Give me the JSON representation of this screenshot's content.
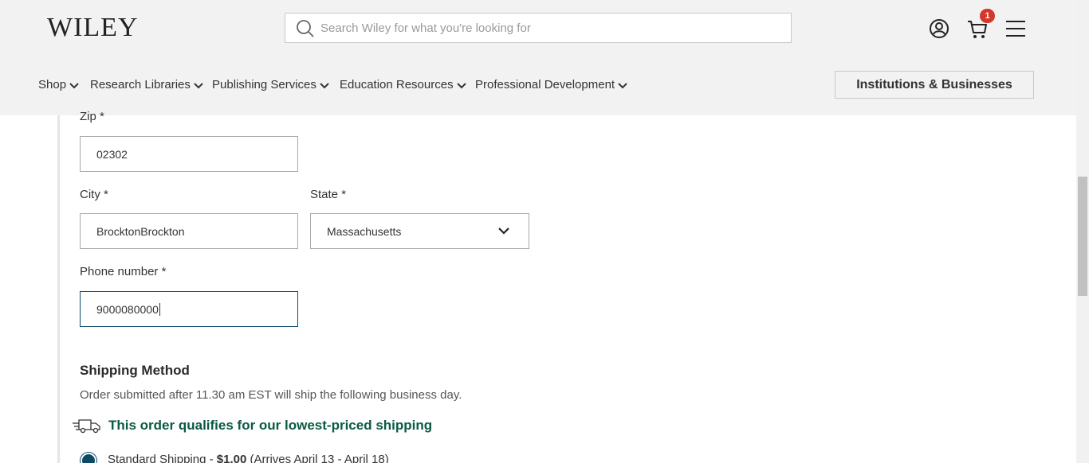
{
  "header": {
    "logo_text": "WILEY",
    "search_placeholder": "Search Wiley for what you're looking for",
    "cart_count": "1",
    "icons": [
      "search-icon",
      "account-icon",
      "cart-icon",
      "menu-icon"
    ]
  },
  "nav": {
    "items": [
      {
        "label": "Shop"
      },
      {
        "label": "Research Libraries"
      },
      {
        "label": "Publishing Services"
      },
      {
        "label": "Education Resources"
      },
      {
        "label": "Professional Development"
      }
    ],
    "institutions_button": "Institutions & Businesses"
  },
  "form": {
    "zip_label": "Zip *",
    "zip_value": "02302",
    "city_label": "City *",
    "city_value": "BrocktonBrockton",
    "state_label": "State *",
    "state_value": "Massachusetts",
    "phone_label": "Phone number *",
    "phone_value": "9000080000"
  },
  "shipping": {
    "title": "Shipping Method",
    "note": "Order submitted after 11.30 am EST will ship the following business day.",
    "qualify_text": "This order qualifies for our lowest-priced shipping",
    "option_name": "Standard Shipping - ",
    "option_price": "$1.00",
    "option_dates": " (Arrives April 13 - April 18)"
  },
  "colors": {
    "header_bg": "#f2f2f2",
    "accent_green": "#0a5a44",
    "focus_border": "#0c4a66",
    "badge": "#d4372c"
  }
}
